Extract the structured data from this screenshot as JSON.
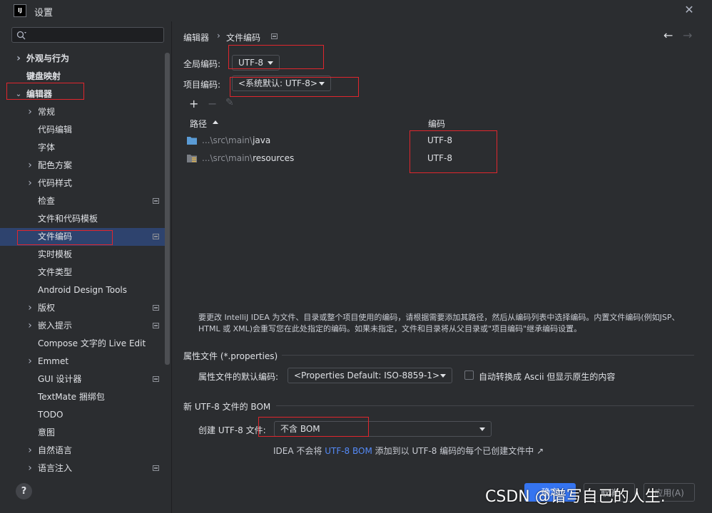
{
  "window": {
    "title": "设置",
    "app_icon_text": "IJ"
  },
  "sidebar": {
    "search_placeholder": "",
    "items": [
      {
        "label": "外观与行为",
        "expandable": true,
        "expanded": false,
        "bold": true,
        "indent": 0
      },
      {
        "label": "键盘映射",
        "expandable": false,
        "bold": true,
        "indent": 0
      },
      {
        "label": "编辑器",
        "expandable": true,
        "expanded": true,
        "bold": true,
        "indent": 0
      },
      {
        "label": "常规",
        "expandable": true,
        "expanded": false,
        "indent": 1
      },
      {
        "label": "代码编辑",
        "indent": 1
      },
      {
        "label": "字体",
        "indent": 1
      },
      {
        "label": "配色方案",
        "expandable": true,
        "expanded": false,
        "indent": 1
      },
      {
        "label": "代码样式",
        "expandable": true,
        "expanded": false,
        "indent": 1
      },
      {
        "label": "检查",
        "indent": 1,
        "project_icon": true
      },
      {
        "label": "文件和代码模板",
        "indent": 1
      },
      {
        "label": "文件编码",
        "indent": 1,
        "project_icon": true,
        "selected": true
      },
      {
        "label": "实时模板",
        "indent": 1
      },
      {
        "label": "文件类型",
        "indent": 1
      },
      {
        "label": "Android Design Tools",
        "indent": 1
      },
      {
        "label": "版权",
        "expandable": true,
        "expanded": false,
        "indent": 1,
        "project_icon": true
      },
      {
        "label": "嵌入提示",
        "expandable": true,
        "expanded": false,
        "indent": 1,
        "project_icon": true
      },
      {
        "label": "Compose 文字的 Live Edit",
        "indent": 1
      },
      {
        "label": "Emmet",
        "expandable": true,
        "expanded": false,
        "indent": 1
      },
      {
        "label": "GUI 设计器",
        "indent": 1,
        "project_icon": true
      },
      {
        "label": "TextMate 捆绑包",
        "indent": 1
      },
      {
        "label": "TODO",
        "indent": 1
      },
      {
        "label": "意图",
        "indent": 1
      },
      {
        "label": "自然语言",
        "expandable": true,
        "expanded": false,
        "indent": 1
      },
      {
        "label": "语言注入",
        "expandable": true,
        "expanded": false,
        "indent": 1,
        "project_icon": true
      }
    ],
    "help_label": "?"
  },
  "breadcrumb": {
    "parent": "编辑器",
    "separator": "›",
    "current": "文件编码"
  },
  "nav": {
    "back": "←",
    "forward": "→"
  },
  "global_encoding": {
    "label": "全局编码:",
    "value": "UTF-8"
  },
  "project_encoding": {
    "label": "项目编码:",
    "value": "<系统默认: UTF-8>"
  },
  "table": {
    "toolbar": {
      "add": "+",
      "remove": "−",
      "edit": "✎"
    },
    "col_path": "路径",
    "col_encoding": "编码",
    "rows": [
      {
        "path_prefix": "...\\src\\main\\",
        "path_name": "java",
        "encoding": "UTF-8",
        "icon": "folder-icon"
      },
      {
        "path_prefix": "...\\src\\main\\",
        "path_name": "resources",
        "encoding": "UTF-8",
        "icon": "resources-folder-icon"
      }
    ]
  },
  "note": "要更改 IntelliJ IDEA 为文件、目录或整个项目使用的编码，请根据需要添加其路径，然后从编码列表中选择编码。内置文件编码(例如JSP、HTML 或 XML)会重写您在此处指定的编码。如果未指定，文件和目录将从父目录或\"项目编码\"继承编码设置。",
  "properties": {
    "section_title": "属性文件 (*.properties)",
    "default_label": "属性文件的默认编码:",
    "default_value": "<Properties Default: ISO-8859-1>",
    "ascii_label": "自动转换成 Ascii 但显示原生的内容"
  },
  "bom": {
    "section_title": "新 UTF-8 文件的 BOM",
    "create_label": "创建 UTF-8 文件:",
    "create_value": "不含 BOM",
    "info_prefix": "IDEA 不会将 ",
    "info_link": "UTF-8 BOM",
    "info_suffix": " 添加到以 UTF-8 编码的每个已创建文件中 ↗"
  },
  "footer": {
    "ok": "确定",
    "cancel": "取消",
    "apply": "应用(A)"
  },
  "watermark": "CSDN @谱写自己的人生.",
  "colors": {
    "background": "#2b2d30",
    "selection": "#2e436e",
    "accent": "#3574f0",
    "link": "#548af7",
    "highlight_box": "#e0262d",
    "folder_icon": "#5a9bd5"
  }
}
